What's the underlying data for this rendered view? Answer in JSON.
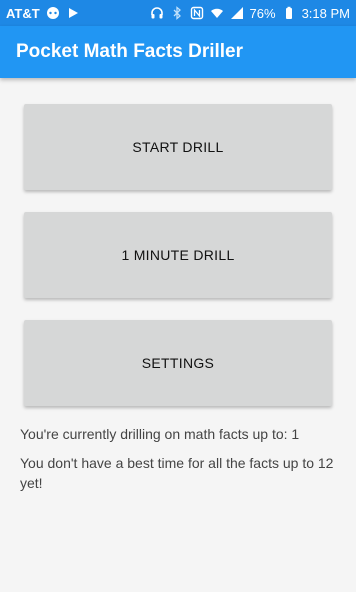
{
  "status_bar": {
    "carrier": "AT&T",
    "battery_percent": "76%",
    "time": "3:18 PM",
    "icons": [
      "message-icon",
      "play-icon",
      "headphones-icon",
      "bluetooth-icon",
      "nfc-icon",
      "wifi-icon",
      "signal-icon",
      "battery-icon"
    ]
  },
  "app_bar": {
    "title": "Pocket Math Facts Driller",
    "color": "#2196f3"
  },
  "buttons": {
    "start_drill": "START DRILL",
    "one_minute_drill": "1 MINUTE DRILL",
    "settings": "SETTINGS"
  },
  "info": {
    "drilling_status": "You're currently drilling on math facts up to: 1",
    "best_time_status": "You don't have a best time for all the facts up to 12 yet!"
  }
}
